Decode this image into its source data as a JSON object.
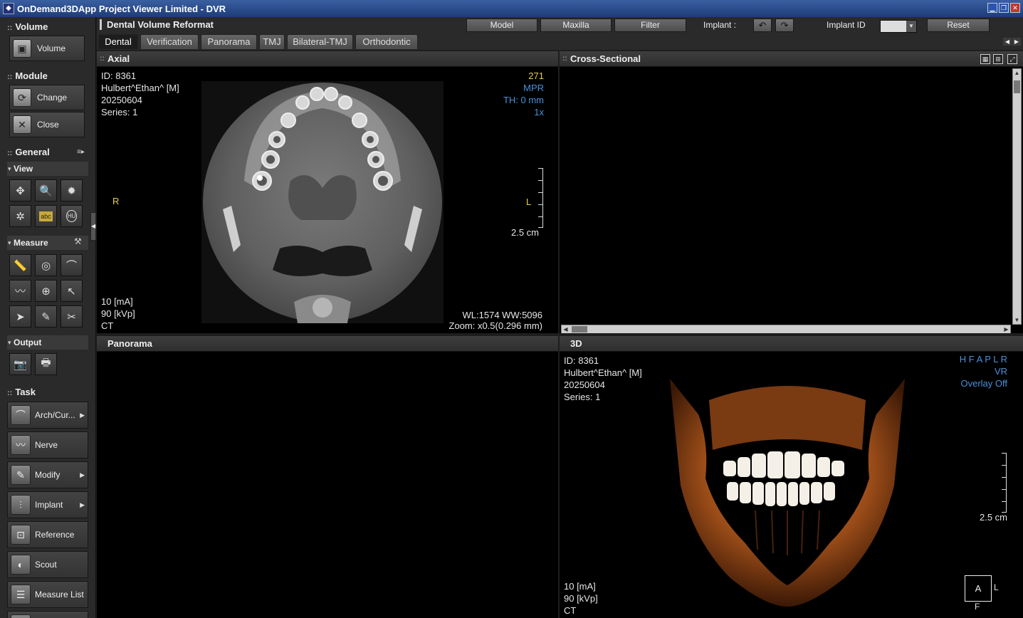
{
  "window": {
    "title": "OnDemand3DApp Project Viewer Limited - DVR",
    "app_icon": "app-logo-icon"
  },
  "left_panel": {
    "volume": {
      "title": "Volume",
      "button": "Volume"
    },
    "module": {
      "title": "Module",
      "change": "Change",
      "close": "Close"
    },
    "general": {
      "title": "General"
    },
    "view": {
      "title": "View",
      "tool_icons": [
        "pan-icon",
        "zoom-icon",
        "window-level-icon",
        "rotate-icon",
        "text-annotation-icon",
        "hu-value-icon"
      ],
      "text_tool_label": "abc",
      "hu_tool_label": "HU"
    },
    "measure": {
      "title": "Measure",
      "tool_icons": [
        "ruler-icon",
        "tape-measure-icon",
        "angle-icon",
        "profile-icon",
        "area-icon",
        "arrow-annotation-icon",
        "select-icon",
        "eraser-icon",
        "delete-icon"
      ]
    },
    "output": {
      "title": "Output",
      "tool_icons": [
        "camera-icon",
        "print-icon"
      ]
    },
    "task": {
      "title": "Task",
      "items": [
        {
          "label": "Arch/Cur...",
          "has_arrow": true
        },
        {
          "label": "Nerve",
          "has_arrow": false
        },
        {
          "label": "Modify",
          "has_arrow": true
        },
        {
          "label": "Implant",
          "has_arrow": true
        },
        {
          "label": "Reference",
          "has_arrow": false
        },
        {
          "label": "Scout",
          "has_arrow": false
        },
        {
          "label": "Measure List",
          "has_arrow": false
        }
      ]
    }
  },
  "top": {
    "module_title": "Dental Volume Reformat",
    "tabs": [
      "Dental",
      "Verification",
      "Panorama",
      "TMJ",
      "Bilateral-TMJ",
      "Orthodontic"
    ],
    "active_tab": "Dental",
    "buttons": {
      "model": "Model",
      "maxilla": "Maxilla",
      "filter": "Filter",
      "reset": "Reset"
    },
    "implant_label": "Implant :",
    "implant_id_label": "Implant ID",
    "implant_id_value": ""
  },
  "viewports": {
    "axial": {
      "title": "Axial",
      "info_left": [
        "ID: 8361",
        "Hulbert^Ethan^ [M]",
        "20250604",
        "Series: 1"
      ],
      "slice_number": "271",
      "info_right": [
        "MPR",
        "TH: 0 mm",
        "1x"
      ],
      "orient_left": "R",
      "orient_right": "L",
      "scale": "2.5 cm",
      "acq": [
        "10 [mA]",
        "90 [kVp]",
        "CT"
      ],
      "wl": "WL:1574 WW:5096",
      "zoom": "Zoom: x0.5(0.296 mm)"
    },
    "cross_sectional": {
      "title": "Cross-Sectional"
    },
    "panorama": {
      "title": "Panorama"
    },
    "three_d": {
      "title": "3D",
      "info_left": [
        "ID: 8361",
        "Hulbert^Ethan^ [M]",
        "20250604",
        "Series: 1"
      ],
      "info_right": [
        "H F A P L R",
        "VR",
        "Overlay Off"
      ],
      "scale": "2.5 cm",
      "acq": [
        "10 [mA]",
        "90 [kVp]",
        "CT"
      ],
      "orient_cube": {
        "front": "A",
        "right": "L",
        "bottom": "F"
      }
    }
  },
  "colors": {
    "overlay_blue": "#4a90d9",
    "overlay_yellow": "#e6d04a",
    "bone_orange": "#b06020"
  }
}
